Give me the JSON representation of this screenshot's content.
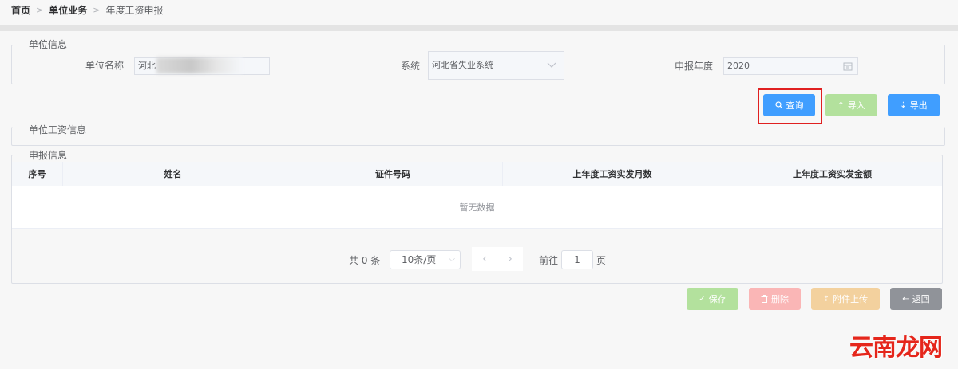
{
  "breadcrumb": {
    "home": "首页",
    "parent": "单位业务",
    "current": "年度工资申报",
    "sep": ">"
  },
  "unit_info": {
    "legend": "单位信息",
    "name_label": "单位名称",
    "name_value": "河北",
    "system_label": "系统",
    "system_value": "河北省失业系统",
    "year_label": "申报年度",
    "year_value": "2020"
  },
  "actions": {
    "query": "查询",
    "import": "导入",
    "export": "导出"
  },
  "wage_info": {
    "legend": "单位工资信息"
  },
  "declare_info": {
    "legend": "申报信息",
    "columns": [
      "序号",
      "姓名",
      "证件号码",
      "上年度工资实发月数",
      "上年度工资实发金额"
    ],
    "empty_text": "暂无数据"
  },
  "pagination": {
    "total": "共 0 条",
    "page_size": "10条/页",
    "goto": "前往",
    "page_value": "1",
    "page_suffix": "页"
  },
  "footer": {
    "save": "保存",
    "delete": "删除",
    "upload": "附件上传",
    "back": "返回"
  },
  "watermark": "云南龙网",
  "colors": {
    "primary": "#409eff",
    "success_light": "#b3e19d",
    "danger_light": "#fab6b6",
    "warning_light": "#f3d19e",
    "info": "#909399",
    "highlight": "#e02020"
  }
}
